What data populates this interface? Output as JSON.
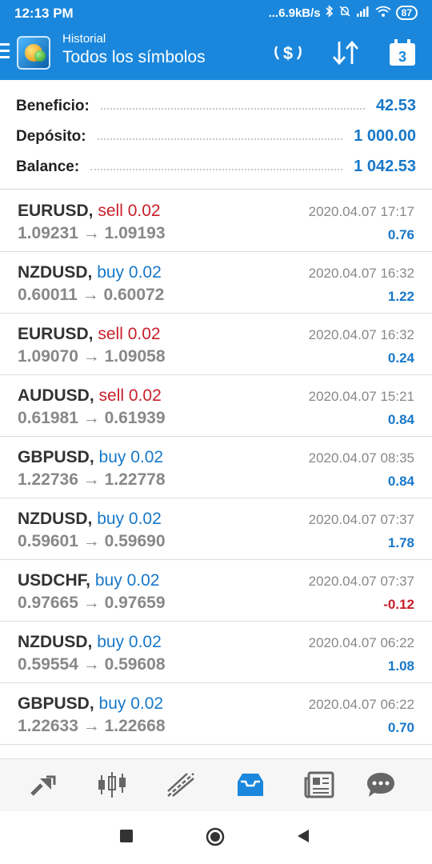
{
  "status_bar": {
    "time": "12:13 PM",
    "network": "...6.9kB/s",
    "battery": "87"
  },
  "app_bar": {
    "subtitle": "Historial",
    "title": "Todos los símbolos",
    "calendar_day": "3"
  },
  "summary": [
    {
      "label": "Beneficio:",
      "value": "42.53"
    },
    {
      "label": "Depósito:",
      "value": "1 000.00"
    },
    {
      "label": "Balance:",
      "value": "1 042.53"
    }
  ],
  "trades": [
    {
      "symbol": "EURUSD,",
      "side": "sell",
      "volume": "0.02",
      "open": "1.09231",
      "close": "1.09193",
      "arrow": "→",
      "date": "2020.04.07 17:17",
      "profit": "0.76"
    },
    {
      "symbol": "NZDUSD,",
      "side": "buy",
      "volume": "0.02",
      "open": "0.60011",
      "close": "0.60072",
      "arrow": "→",
      "date": "2020.04.07 16:32",
      "profit": "1.22"
    },
    {
      "symbol": "EURUSD,",
      "side": "sell",
      "volume": "0.02",
      "open": "1.09070",
      "close": "1.09058",
      "arrow": "→",
      "date": "2020.04.07 16:32",
      "profit": "0.24"
    },
    {
      "symbol": "AUDUSD,",
      "side": "sell",
      "volume": "0.02",
      "open": "0.61981",
      "close": "0.61939",
      "arrow": "→",
      "date": "2020.04.07 15:21",
      "profit": "0.84"
    },
    {
      "symbol": "GBPUSD,",
      "side": "buy",
      "volume": "0.02",
      "open": "1.22736",
      "close": "1.22778",
      "arrow": "→",
      "date": "2020.04.07 08:35",
      "profit": "0.84"
    },
    {
      "symbol": "NZDUSD,",
      "side": "buy",
      "volume": "0.02",
      "open": "0.59601",
      "close": "0.59690",
      "arrow": "→",
      "date": "2020.04.07 07:37",
      "profit": "1.78"
    },
    {
      "symbol": "USDCHF,",
      "side": "buy",
      "volume": "0.02",
      "open": "0.97665",
      "close": "0.97659",
      "arrow": "→",
      "date": "2020.04.07 07:37",
      "profit": "-0.12"
    },
    {
      "symbol": "NZDUSD,",
      "side": "buy",
      "volume": "0.02",
      "open": "0.59554",
      "close": "0.59608",
      "arrow": "→",
      "date": "2020.04.07 06:22",
      "profit": "1.08"
    },
    {
      "symbol": "GBPUSD,",
      "side": "buy",
      "volume": "0.02",
      "open": "1.22633",
      "close": "1.22668",
      "arrow": "→",
      "date": "2020.04.07 06:22",
      "profit": "0.70"
    }
  ],
  "bottom_nav": [
    {
      "icon": "quotes-icon"
    },
    {
      "icon": "chart-icon"
    },
    {
      "icon": "trade-icon"
    },
    {
      "icon": "history-icon"
    },
    {
      "icon": "news-icon"
    },
    {
      "icon": "chat-icon"
    }
  ],
  "colors": {
    "brand": "#1a87dc",
    "sell": "#c8202a",
    "buy": "#1878c8",
    "active_nav": "#1a87dc"
  }
}
